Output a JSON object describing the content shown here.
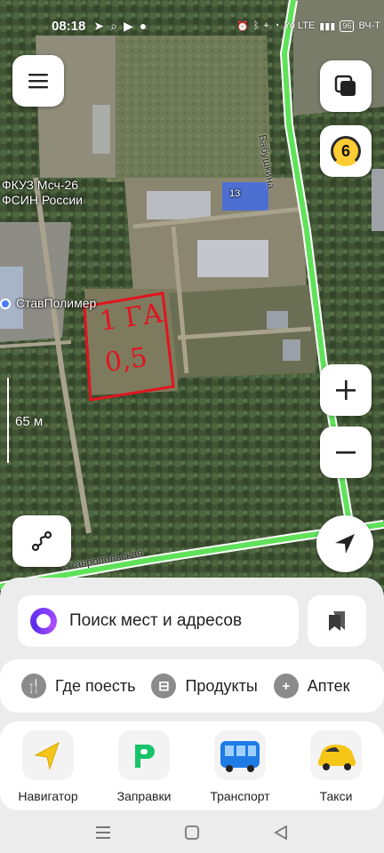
{
  "status_bar": {
    "time": "08:18",
    "network_text": "Yo LTE",
    "battery": "96",
    "carrier": "ВЧ-Т"
  },
  "map": {
    "labels": {
      "fkuz_line1": "ФКУЗ Мсч-26",
      "fkuz_line2": "ФСИН России",
      "stavpolimer": "СтавПолимер",
      "street_vertical": "Бабушкина",
      "street_bottom": "Ставропольская",
      "building_number": "13"
    },
    "scale": "65 м",
    "traffic_level": "6",
    "annotation": {
      "text_top": "1 ГА",
      "text_bottom": "0,5",
      "color": "#e2141e"
    },
    "colors": {
      "road": "#5fe25a",
      "annotation": "#e2141e"
    }
  },
  "search": {
    "placeholder": "Поиск мест и адресов"
  },
  "categories": [
    {
      "label": "Где поесть",
      "icon": "fork-knife-icon"
    },
    {
      "label": "Продукты",
      "icon": "basket-icon"
    },
    {
      "label": "Аптек",
      "icon": "plus-icon"
    }
  ],
  "apps": [
    {
      "label": "Навигатор",
      "icon": "navigator-icon"
    },
    {
      "label": "Заправки",
      "icon": "fuel-icon"
    },
    {
      "label": "Транспорт",
      "icon": "bus-icon"
    },
    {
      "label": "Такси",
      "icon": "taxi-icon"
    }
  ]
}
